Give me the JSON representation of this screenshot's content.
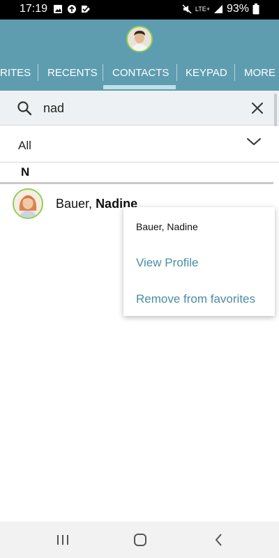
{
  "status_bar": {
    "time": "17:19",
    "battery": "93%",
    "network": "LTE+",
    "icons": [
      "image-icon",
      "sync-icon",
      "checkmark-icon",
      "mute-icon",
      "wifi-calling-icon",
      "signal-icon",
      "battery-icon"
    ]
  },
  "header": {
    "tabs": [
      {
        "label": "RITES"
      },
      {
        "label": "RECENTS"
      },
      {
        "label": "CONTACTS"
      },
      {
        "label": "KEYPAD"
      },
      {
        "label": "MORE"
      }
    ],
    "active_tab": "CONTACTS",
    "colors": {
      "header_bg": "#5e9db0",
      "active_underline": "#bfe0ea",
      "avatar_ring": "#8ccf55"
    }
  },
  "search": {
    "value": "nad",
    "icon": "search-icon",
    "clear_icon": "close-icon"
  },
  "filter": {
    "selected": "All",
    "icon": "chevron-down-icon"
  },
  "section": {
    "letter": "N"
  },
  "contact": {
    "last_name": "Bauer,",
    "first_name": "Nadine"
  },
  "context_menu": {
    "title": "Bauer, Nadine",
    "items": [
      {
        "label": "View Profile"
      },
      {
        "label": "Remove from favorites"
      }
    ],
    "item_color": "#4a8da0"
  },
  "nav_bar": {
    "icons": [
      "recent-apps-icon",
      "home-icon",
      "back-icon"
    ]
  }
}
